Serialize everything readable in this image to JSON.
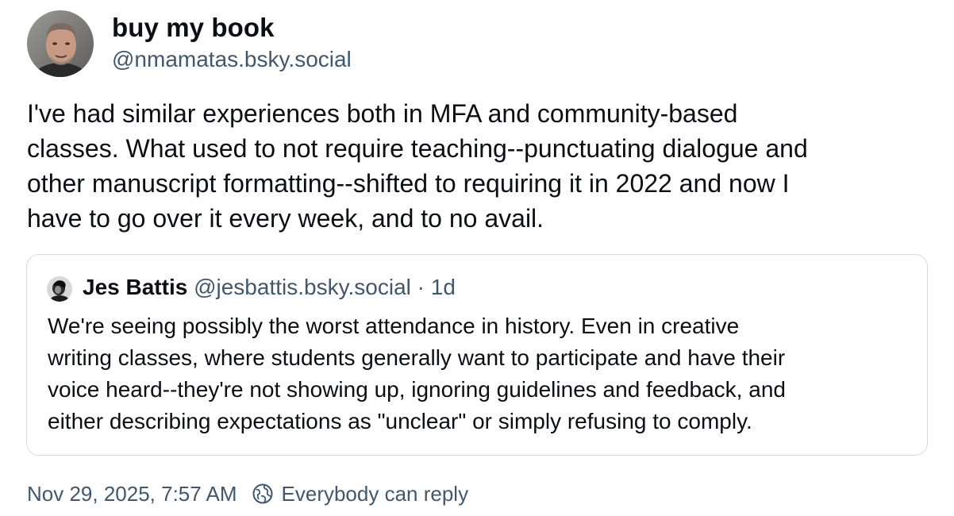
{
  "post": {
    "author": {
      "display_name": "buy my book",
      "handle": "@nmamatas.bsky.social",
      "avatar_icon": "user-avatar-photo"
    },
    "text_lines": [
      "I've had similar experiences both in MFA and community-based",
      "classes. What used to not require teaching--punctuating dialogue and",
      "other manuscript formatting--shifted to requiring it in 2022 and now I",
      "have to go over it every week, and to no avail."
    ],
    "quote": {
      "author_name": "Jes Battis",
      "author_handle": "@jesbattis.bsky.social",
      "separator": "·",
      "time": "1d",
      "text_lines": [
        "We're seeing possibly the worst attendance in history. Even in creative",
        "writing classes, where students generally want to participate and have their",
        "voice heard--they're not showing up, ignoring guidelines and feedback, and",
        "either describing expectations as \"unclear\" or simply refusing to comply."
      ]
    },
    "footer": {
      "timestamp": "Nov 29, 2025, 7:57 AM",
      "reply_setting": "Everybody can reply",
      "reply_icon": "earth-reply-icon"
    }
  },
  "colors": {
    "text_primary": "#0b0f14",
    "text_secondary": "#42576c",
    "border": "#d4dbe2",
    "background": "#ffffff"
  }
}
